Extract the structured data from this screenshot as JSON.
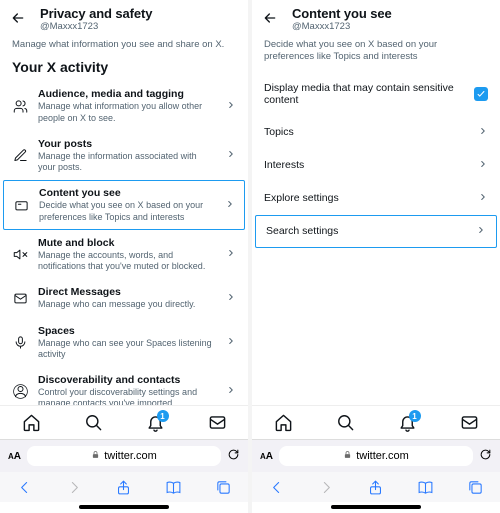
{
  "left": {
    "header": {
      "title": "Privacy and safety",
      "handle": "@Maxxx1723"
    },
    "page_desc": "Manage what information you see and share on X.",
    "section": "Your X activity",
    "rows": [
      {
        "title": "Audience, media and tagging",
        "desc": "Manage what information you allow other people on X to see."
      },
      {
        "title": "Your posts",
        "desc": "Manage the information associated with your posts."
      },
      {
        "title": "Content you see",
        "desc": "Decide what you see on X based on your preferences like Topics and interests"
      },
      {
        "title": "Mute and block",
        "desc": "Manage the accounts, words, and notifications that you've muted or blocked."
      },
      {
        "title": "Direct Messages",
        "desc": "Manage who can message you directly."
      },
      {
        "title": "Spaces",
        "desc": "Manage who can see your Spaces listening activity"
      },
      {
        "title": "Discoverability and contacts",
        "desc": "Control your discoverability settings and manage contacts you've imported."
      }
    ]
  },
  "right": {
    "header": {
      "title": "Content you see",
      "handle": "@Maxxx1723"
    },
    "page_desc": "Decide what you see on X based on your preferences like Topics and interests",
    "toggle_label": "Display media that may contain sensitive content",
    "rows": [
      "Topics",
      "Interests",
      "Explore settings",
      "Search settings"
    ]
  },
  "notif_badge": "1",
  "browser": {
    "url": "twitter.com"
  }
}
